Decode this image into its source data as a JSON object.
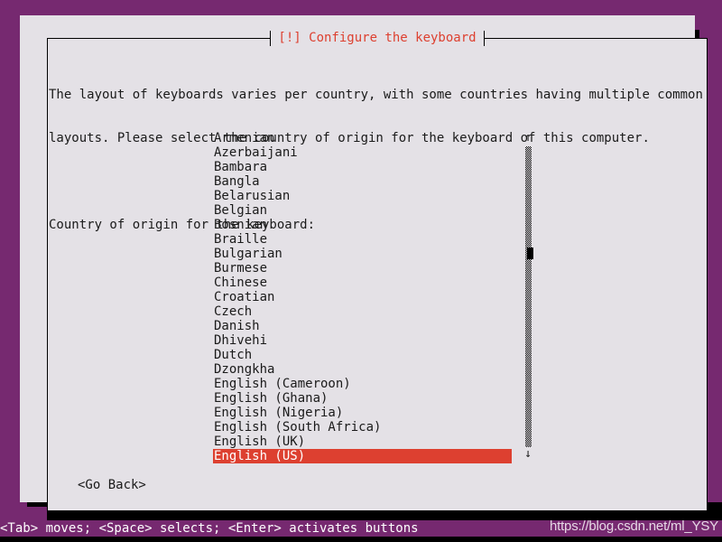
{
  "theme": {
    "desktop_purple": "#762970",
    "dialog_background": "#e4e1e6",
    "accent_red": "#dd4030",
    "text_color": "#1a1a1a",
    "shadow_color": "#000000"
  },
  "dialog": {
    "title": "[!] Configure the keyboard",
    "paragraph_line_1": "The layout of keyboards varies per country, with some countries having multiple common",
    "paragraph_line_2": "layouts. Please select the country of origin for the keyboard of this computer.",
    "prompt": "Country of origin for the keyboard:"
  },
  "list": {
    "items": [
      {
        "label": "Armenian",
        "selected": false
      },
      {
        "label": "Azerbaijani",
        "selected": false
      },
      {
        "label": "Bambara",
        "selected": false
      },
      {
        "label": "Bangla",
        "selected": false
      },
      {
        "label": "Belarusian",
        "selected": false
      },
      {
        "label": "Belgian",
        "selected": false
      },
      {
        "label": "Bosnian",
        "selected": false
      },
      {
        "label": "Braille",
        "selected": false
      },
      {
        "label": "Bulgarian",
        "selected": false
      },
      {
        "label": "Burmese",
        "selected": false
      },
      {
        "label": "Chinese",
        "selected": false
      },
      {
        "label": "Croatian",
        "selected": false
      },
      {
        "label": "Czech",
        "selected": false
      },
      {
        "label": "Danish",
        "selected": false
      },
      {
        "label": "Dhivehi",
        "selected": false
      },
      {
        "label": "Dutch",
        "selected": false
      },
      {
        "label": "Dzongkha",
        "selected": false
      },
      {
        "label": "English (Cameroon)",
        "selected": false
      },
      {
        "label": "English (Ghana)",
        "selected": false
      },
      {
        "label": "English (Nigeria)",
        "selected": false
      },
      {
        "label": "English (South Africa)",
        "selected": false
      },
      {
        "label": "English (UK)",
        "selected": false
      },
      {
        "label": "English (US)",
        "selected": true
      }
    ],
    "selected_value": "English (US)"
  },
  "scrollbar": {
    "up_arrow": "↑",
    "down_arrow": "↓",
    "thumb_position_percent": 33
  },
  "buttons": {
    "go_back": "<Go Back>"
  },
  "status": {
    "help_text": "<Tab> moves; <Space> selects; <Enter> activates buttons",
    "watermark": "https://blog.csdn.net/ml_YSY"
  }
}
